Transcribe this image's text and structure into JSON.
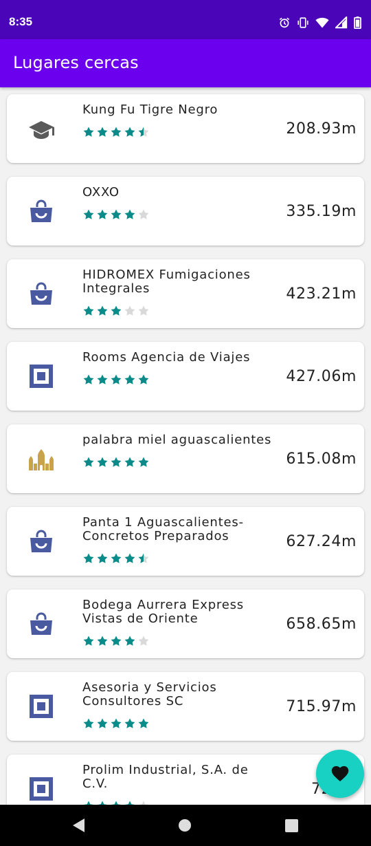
{
  "status_bar": {
    "time": "8:35",
    "icons": [
      "alarm-icon",
      "vibrate-icon",
      "wifi-icon",
      "signal-icon",
      "battery-icon"
    ]
  },
  "app_bar": {
    "title": "Lugares cercas"
  },
  "colors": {
    "status_bar": "#4b05b8",
    "app_bar": "#6a00ee",
    "star_filled": "#0b8a8a",
    "star_empty": "#d9d9d9",
    "icon_blue": "#4a5aa0",
    "icon_gold": "#c9a24c",
    "icon_gray": "#5a5a5a",
    "fab": "#19d1c2"
  },
  "places": [
    {
      "name": "Kung Fu Tigre Negro",
      "icon": "school-icon",
      "rating": 4.5,
      "distance": "208.93m"
    },
    {
      "name": "OXXO",
      "icon": "shopping-bag-icon",
      "rating": 4,
      "distance": "335.19m"
    },
    {
      "name": "HIDROMEX Fumigaciones Integrales",
      "icon": "shopping-bag-icon",
      "rating": 3,
      "distance": "423.21m"
    },
    {
      "name": "Rooms Agencia de Viajes",
      "icon": "generic-place-icon",
      "rating": 5,
      "distance": "427.06m"
    },
    {
      "name": "palabra miel aguascalientes",
      "icon": "place-of-worship-icon",
      "rating": 5,
      "distance": "615.08m"
    },
    {
      "name": "Panta 1 Aguascalientes-Concretos Preparados",
      "icon": "shopping-bag-icon",
      "rating": 4.5,
      "distance": "627.24m"
    },
    {
      "name": "Bodega Aurrera Express Vistas de Oriente",
      "icon": "shopping-bag-icon",
      "rating": 4,
      "distance": "658.65m"
    },
    {
      "name": "Asesoria y Servicios Consultores SC",
      "icon": "generic-place-icon",
      "rating": 5,
      "distance": "715.97m"
    },
    {
      "name": "Prolim Industrial, S.A. de C.V.",
      "icon": "generic-place-icon",
      "rating": 4,
      "distance": "729.5"
    }
  ],
  "fab": {
    "icon": "heart-icon"
  },
  "nav_bar": {
    "icons": [
      "back-icon",
      "home-icon",
      "recents-icon"
    ]
  }
}
